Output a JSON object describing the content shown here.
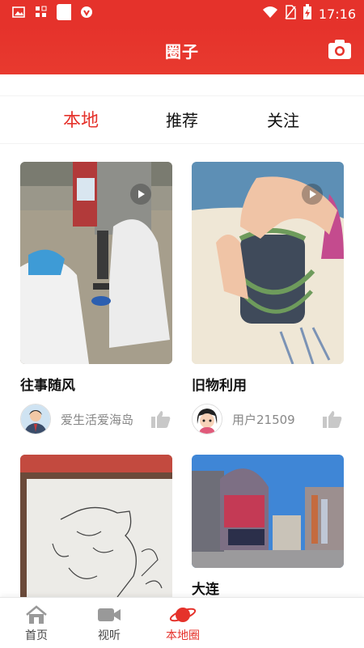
{
  "status_bar": {
    "time": "17:16",
    "left_icons": [
      "image-icon",
      "apps-icon",
      "white-square-icon",
      "shield-icon"
    ],
    "right_icons": [
      "wifi-icon",
      "no-sim-icon",
      "battery-charging-icon"
    ]
  },
  "header": {
    "title": "圈子",
    "camera_icon": "camera-icon"
  },
  "tabs": [
    {
      "label": "本地",
      "active": true
    },
    {
      "label": "推荐",
      "active": false
    },
    {
      "label": "关注",
      "active": false
    }
  ],
  "cards": [
    {
      "title": "往事随风",
      "author": "爱生活爱海岛",
      "has_play": true
    },
    {
      "title": "旧物利用",
      "author": "用户21509",
      "has_play": true
    },
    {
      "title": "",
      "author": "",
      "has_play": false
    },
    {
      "title": "大连",
      "author": "",
      "has_play": false
    }
  ],
  "bottom_nav": [
    {
      "label": "首页",
      "icon": "home-icon",
      "active": false
    },
    {
      "label": "视听",
      "icon": "video-icon",
      "active": false
    },
    {
      "label": "本地圈",
      "icon": "planet-icon",
      "active": true
    }
  ],
  "colors": {
    "accent": "#e5322b",
    "text": "#111111",
    "muted": "#888888"
  }
}
